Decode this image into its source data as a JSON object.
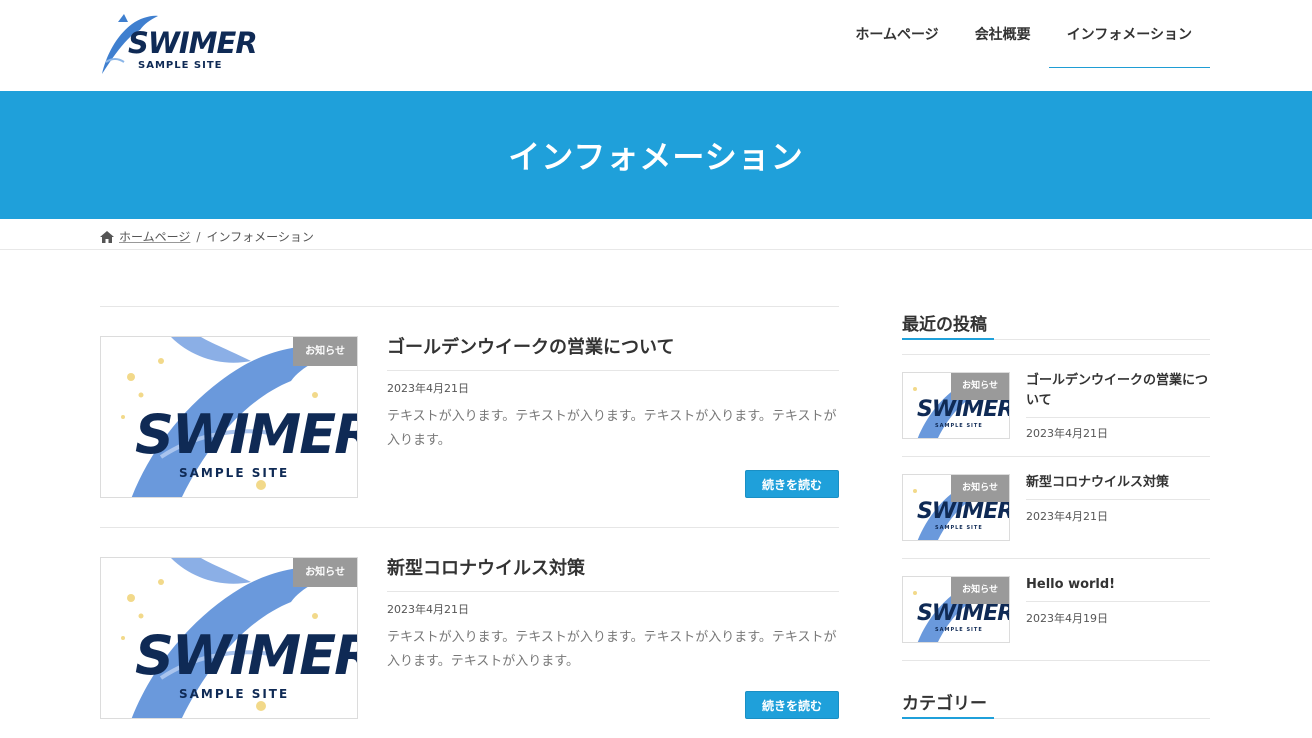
{
  "header": {
    "logo_title": "SWIMER",
    "logo_sub": "SAMPLE SITE",
    "nav": [
      {
        "label": "ホームページ"
      },
      {
        "label": "会社概要"
      },
      {
        "label": "インフォメーション"
      }
    ]
  },
  "hero": {
    "title": "インフォメーション"
  },
  "breadcrumb": {
    "home": "ホームページ",
    "separator": "/",
    "current": "インフォメーション"
  },
  "posts": [
    {
      "badge": "お知らせ",
      "thumb_title": "SWIMER",
      "thumb_sub": "SAMPLE SITE",
      "title": "ゴールデンウイークの営業について",
      "date": "2023年4月21日",
      "excerpt": "テキストが入ります。テキストが入ります。テキストが入ります。テキストが入ります。",
      "read_more": "続きを読む"
    },
    {
      "badge": "お知らせ",
      "thumb_title": "SWIMER",
      "thumb_sub": "SAMPLE SITE",
      "title": "新型コロナウイルス対策",
      "date": "2023年4月21日",
      "excerpt": "テキストが入ります。テキストが入ります。テキストが入ります。テキストが入ります。テキストが入ります。",
      "read_more": "続きを読む"
    }
  ],
  "sidebar": {
    "recent_heading": "最近の投稿",
    "recent": [
      {
        "badge": "お知らせ",
        "thumb_title": "SWIMER",
        "thumb_sub": "SAMPLE SITE",
        "title": "ゴールデンウイークの営業について",
        "date": "2023年4月21日"
      },
      {
        "badge": "お知らせ",
        "thumb_title": "SWIMER",
        "thumb_sub": "SAMPLE SITE",
        "title": "新型コロナウイルス対策",
        "date": "2023年4月21日"
      },
      {
        "badge": "お知らせ",
        "thumb_title": "SWIMER",
        "thumb_sub": "SAMPLE SITE",
        "title": "Hello world!",
        "date": "2023年4月19日"
      }
    ],
    "category_heading": "カテゴリー"
  },
  "colors": {
    "accent": "#1fa0da",
    "badge": "#9a9a9a",
    "logo": "#0f2a55"
  }
}
